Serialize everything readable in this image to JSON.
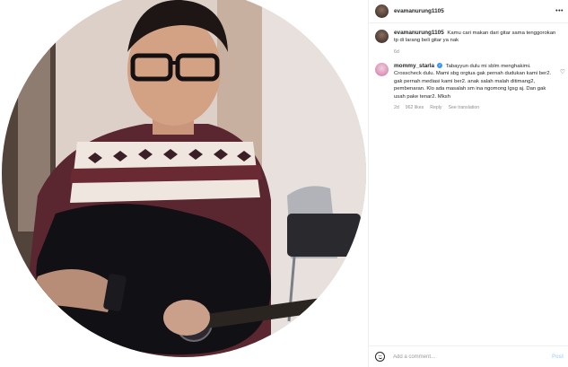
{
  "post": {
    "author": "evamanurung1105",
    "image_alt": "profile photo"
  },
  "comments": [
    {
      "user": "evamanurung1105",
      "verified": false,
      "text": "Kamu cari makan dari gitar sama tenggorokan tp di larang beli gitar ya nak",
      "age": "6d",
      "likes": "",
      "reply": "",
      "translate": ""
    },
    {
      "user": "mommy_starla",
      "verified": true,
      "text": "Tabayyun dulu mi sblm menghakimi. Crosscheck dulu. Mami sbg orgtua gak pernah dudukan kami ber2. gak pernah mediasi kami ber2. anak salah malah ditimang2, pembenaran. Klo ada masalah sm ina ngomong lgsg aj. Dan gak usah pake tenar2. Mksh",
      "age": "2d",
      "likes": "962 likes",
      "reply": "Reply",
      "translate": "See translation"
    }
  ],
  "add_comment": {
    "placeholder": "Add a comment...",
    "post_label": "Post"
  },
  "icons": {
    "options": "more-dots-icon",
    "like": "heart-icon",
    "emoji": "emoji-icon",
    "verified": "verified-badge-icon"
  },
  "colors": {
    "verified": "#3897f0",
    "post_button_disabled": "#b3dbff",
    "meta_text": "#8e8e8e"
  }
}
